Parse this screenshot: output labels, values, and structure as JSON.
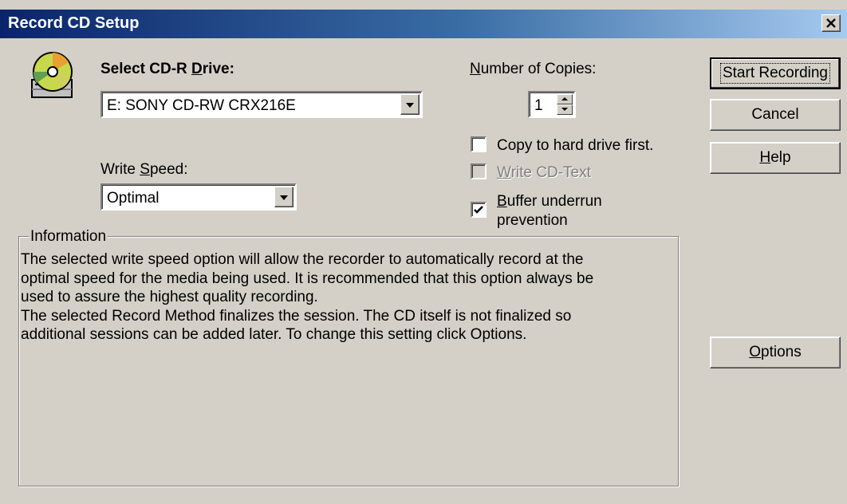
{
  "window": {
    "title": "Record CD Setup",
    "close_label": "x"
  },
  "drive": {
    "label_pre": "Select CD-R ",
    "label_accel": "D",
    "label_post": "rive:",
    "selected": "E: SONY CD-RW  CRX216E"
  },
  "speed": {
    "label_pre": "Write ",
    "label_accel": "S",
    "label_post": "peed:",
    "selected": "Optimal"
  },
  "copies": {
    "label_accel": "N",
    "label_post": "umber of Copies:",
    "value": "1"
  },
  "options": {
    "copy_hd": {
      "label": "Copy to hard drive first.",
      "checked": false
    },
    "cd_text": {
      "label_accel": "W",
      "label_post": "rite CD-Text",
      "checked": false,
      "disabled": true
    },
    "buffer": {
      "label_accel": "B",
      "label_post": "uffer underrun",
      "label_line2": "prevention",
      "checked": true
    }
  },
  "buttons": {
    "start": "Start Recording",
    "cancel": "Cancel",
    "help_accel": "H",
    "help_post": "elp",
    "options_accel": "O",
    "options_post": "ptions"
  },
  "information": {
    "legend": "Information",
    "lines": [
      "The selected write speed option will allow the recorder to automatically record at the",
      "optimal speed for the media being used. It is recommended that this option always be",
      "used to assure the highest quality recording.",
      "The selected Record Method finalizes the session. The CD itself is not finalized so",
      "additional sessions can be added later. To change this setting click Options."
    ]
  },
  "icons": {
    "drive": "cd-drive-icon",
    "checkmark": "checkmark-icon"
  }
}
